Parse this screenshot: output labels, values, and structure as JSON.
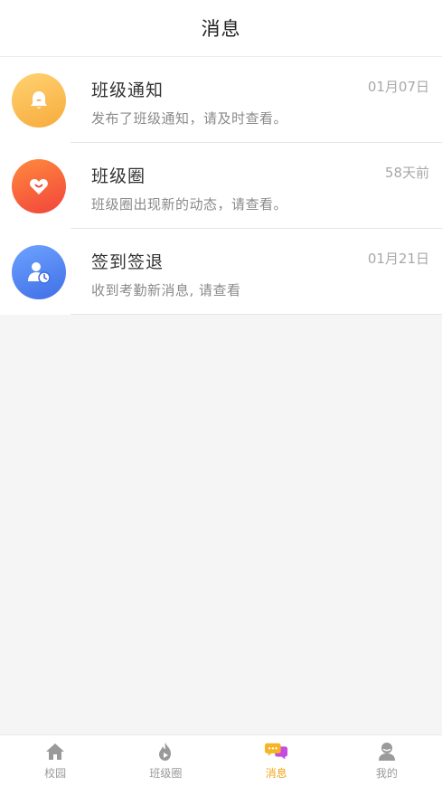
{
  "header": {
    "title": "消息"
  },
  "messages": [
    {
      "title": "班级通知",
      "subtitle": "发布了班级通知，请及时查看。",
      "time": "01月07日",
      "icon": "bell-icon",
      "color": "#f7ab3c"
    },
    {
      "title": "班级圈",
      "subtitle": "班级圈出现新的动态，请查看。",
      "time": "58天前",
      "icon": "heart-smile-icon",
      "color": "#f2443c"
    },
    {
      "title": "签到签退",
      "subtitle": "收到考勤新消息, 请查看",
      "time": "01月21日",
      "icon": "user-clock-icon",
      "color": "#3f6ee6"
    }
  ],
  "tabbar": {
    "tabs": [
      {
        "label": "校园",
        "icon": "home-icon"
      },
      {
        "label": "班级圈",
        "icon": "flame-icon"
      },
      {
        "label": "消息",
        "icon": "chat-bubbles-icon",
        "active": true
      },
      {
        "label": "我的",
        "icon": "profile-icon"
      }
    ],
    "active_color": "#f2a51a",
    "inactive_color": "#9a9a9a"
  }
}
